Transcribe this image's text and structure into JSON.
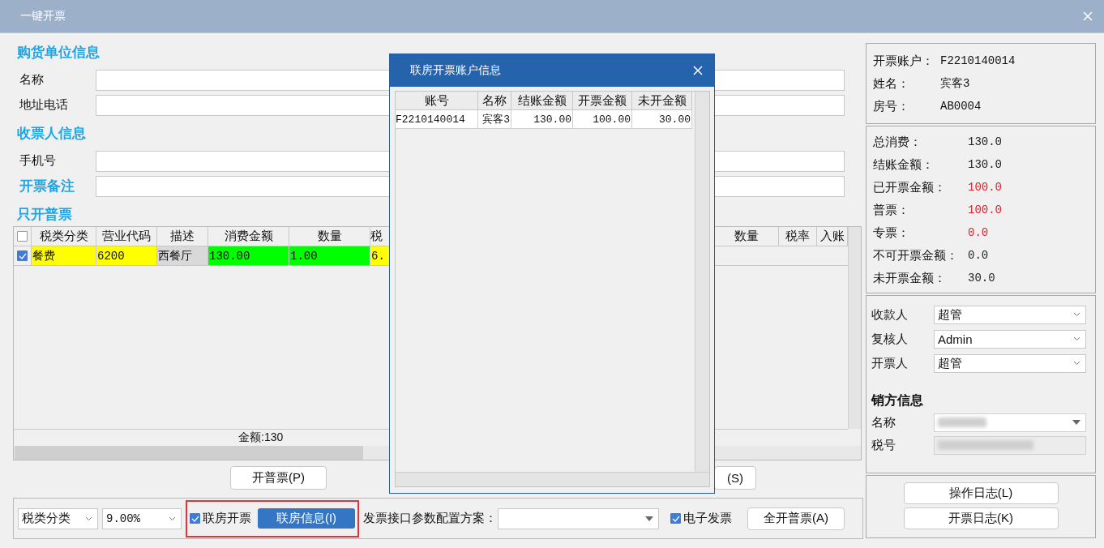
{
  "window": {
    "title": "一键开票"
  },
  "buyer": {
    "heading": "购货单位信息",
    "fields": [
      {
        "label": "名称",
        "kind": "plain"
      },
      {
        "label": "地址电话",
        "kind": "plain"
      }
    ]
  },
  "recipient": {
    "heading": "收票人信息",
    "fields": [
      {
        "label": "手机号",
        "kind": "plain"
      },
      {
        "label": "开票备注",
        "kind": "accent"
      }
    ]
  },
  "items": {
    "heading": "只开普票",
    "all_checked": false,
    "columns": [
      "税类分类",
      "营业代码",
      "描述",
      "消费金额",
      "数量",
      "税",
      "数量",
      "税率",
      "入账"
    ],
    "rows": [
      {
        "checked": true,
        "cells": [
          {
            "text": "餐费",
            "color": "#ffff00"
          },
          {
            "text": "6200",
            "color": "#ffff00"
          },
          {
            "text": "西餐厅",
            "color": "#d9d9d9"
          },
          {
            "text": "130.00",
            "color": "#00ff00"
          },
          {
            "text": "1.00",
            "color": "#00ff00"
          },
          {
            "text": "6.",
            "color": "#ffff00"
          }
        ]
      }
    ],
    "total": "金额:130"
  },
  "action_buttons": [
    "开普票(P)",
    "(S)"
  ],
  "toolbar": {
    "tax_category": "税类分类",
    "tax_rate": "9.00%",
    "joint_room": {
      "label": "联房开票",
      "checked": true,
      "highlight": true
    },
    "info_button": "联房信息(I)",
    "config_label": "发票接口参数配置方案：",
    "e_invoice": {
      "label": "电子发票",
      "checked": true
    },
    "open_all_button": "全开普票(A)"
  },
  "account": [
    {
      "label": "开票账户：",
      "value": "F2210140014"
    },
    {
      "label": "姓名：",
      "value": "宾客3"
    },
    {
      "label": "房号：",
      "value": "AB0004"
    }
  ],
  "summary": [
    {
      "label": "总消费：",
      "value": "130.0",
      "color": "#222222"
    },
    {
      "label": "结账金额：",
      "value": "130.0",
      "color": "#222222"
    },
    {
      "label": "已开票金额：",
      "value": "100.0",
      "color": "#e0202a"
    },
    {
      "label": "普票：",
      "value": "100.0",
      "color": "#e0202a"
    },
    {
      "label": "专票：",
      "value": "0.0",
      "color": "#e0202a"
    },
    {
      "label": "不可开票金额：",
      "value": "0.0",
      "color": "#222222"
    },
    {
      "label": "未开票金额：",
      "value": "30.0",
      "color": "#222222"
    }
  ],
  "staff": [
    {
      "label": "收款人",
      "value": "超管"
    },
    {
      "label": "复核人",
      "value": "Admin"
    },
    {
      "label": "开票人",
      "value": "超管"
    }
  ],
  "seller": {
    "heading": "销方信息",
    "fields": [
      {
        "label": "名称",
        "kind": "dropdown"
      },
      {
        "label": "税号",
        "kind": "readonly"
      }
    ]
  },
  "log_buttons": [
    "操作日志(L)",
    "开票日志(K)"
  ],
  "dialog": {
    "title": "联房开票账户信息",
    "columns": [
      "账号",
      "名称",
      "结账金额",
      "开票金额",
      "未开金额"
    ],
    "rows": [
      [
        "F2210140014",
        "宾客3",
        "130.00",
        "100.00",
        "30.00"
      ]
    ]
  }
}
